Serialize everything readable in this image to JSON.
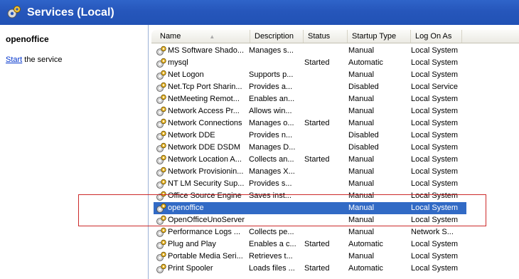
{
  "window": {
    "title": "Services (Local)",
    "icon": "gear-icon"
  },
  "left_pane": {
    "service_name": "openoffice",
    "action_link": "Start",
    "action_rest": " the service"
  },
  "columns": {
    "name": "Name",
    "description": "Description",
    "status": "Status",
    "startup_type": "Startup Type",
    "log_on_as": "Log On As"
  },
  "services": [
    {
      "name": "MS Software Shado...",
      "description": "Manages s...",
      "status": "",
      "startup": "Manual",
      "logon": "Local System"
    },
    {
      "name": "mysql",
      "description": "",
      "status": "Started",
      "startup": "Automatic",
      "logon": "Local System"
    },
    {
      "name": "Net Logon",
      "description": "Supports p...",
      "status": "",
      "startup": "Manual",
      "logon": "Local System"
    },
    {
      "name": "Net.Tcp Port Sharin...",
      "description": "Provides a...",
      "status": "",
      "startup": "Disabled",
      "logon": "Local Service"
    },
    {
      "name": "NetMeeting Remot...",
      "description": "Enables an...",
      "status": "",
      "startup": "Manual",
      "logon": "Local System"
    },
    {
      "name": "Network Access Pr...",
      "description": "Allows win...",
      "status": "",
      "startup": "Manual",
      "logon": "Local System"
    },
    {
      "name": "Network Connections",
      "description": "Manages o...",
      "status": "Started",
      "startup": "Manual",
      "logon": "Local System"
    },
    {
      "name": "Network DDE",
      "description": "Provides n...",
      "status": "",
      "startup": "Disabled",
      "logon": "Local System"
    },
    {
      "name": "Network DDE DSDM",
      "description": "Manages D...",
      "status": "",
      "startup": "Disabled",
      "logon": "Local System"
    },
    {
      "name": "Network Location A...",
      "description": "Collects an...",
      "status": "Started",
      "startup": "Manual",
      "logon": "Local System"
    },
    {
      "name": "Network Provisionin...",
      "description": "Manages X...",
      "status": "",
      "startup": "Manual",
      "logon": "Local System"
    },
    {
      "name": "NT LM Security Sup...",
      "description": "Provides s...",
      "status": "",
      "startup": "Manual",
      "logon": "Local System"
    },
    {
      "name": "Office Source Engine",
      "description": "Saves inst...",
      "status": "",
      "startup": "Manual",
      "logon": "Local System"
    },
    {
      "name": "openoffice",
      "description": "",
      "status": "",
      "startup": "Manual",
      "logon": "Local System",
      "selected": true
    },
    {
      "name": "OpenOfficeUnoServer",
      "description": "",
      "status": "",
      "startup": "Manual",
      "logon": "Local System"
    },
    {
      "name": "Performance Logs ...",
      "description": "Collects pe...",
      "status": "",
      "startup": "Manual",
      "logon": "Network S..."
    },
    {
      "name": "Plug and Play",
      "description": "Enables a c...",
      "status": "Started",
      "startup": "Automatic",
      "logon": "Local System"
    },
    {
      "name": "Portable Media Seri...",
      "description": "Retrieves t...",
      "status": "",
      "startup": "Manual",
      "logon": "Local System"
    },
    {
      "name": "Print Spooler",
      "description": "Loads files ...",
      "status": "Started",
      "startup": "Automatic",
      "logon": "Local System"
    }
  ],
  "accent_colors": {
    "titlebar": "#2656bb",
    "selection": "#316ac5",
    "highlight_box": "#cc2a2a"
  }
}
